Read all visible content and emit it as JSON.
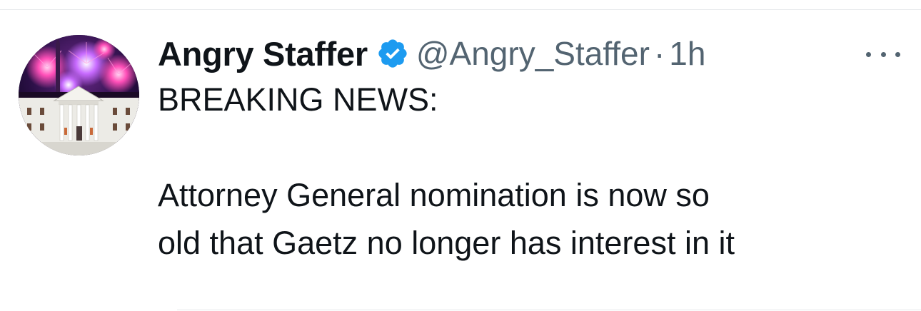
{
  "tweet": {
    "author": {
      "display_name": "Angry Staffer",
      "handle": "@Angry_Staffer",
      "verified": true,
      "verified_color": "#1d9bf0",
      "avatar_icon": "white-house-fireworks-avatar"
    },
    "separator": "·",
    "time": "1h",
    "more_icon": "more-horizontal-icon",
    "text_lines": [
      "BREAKING NEWS:",
      "",
      "Attorney General nomination is now so",
      "old that Gaetz no longer has interest in it"
    ]
  },
  "colors": {
    "text_primary": "#0f1419",
    "text_secondary": "#536471",
    "divider": "#e6e9eb",
    "verified_blue": "#1d9bf0"
  }
}
